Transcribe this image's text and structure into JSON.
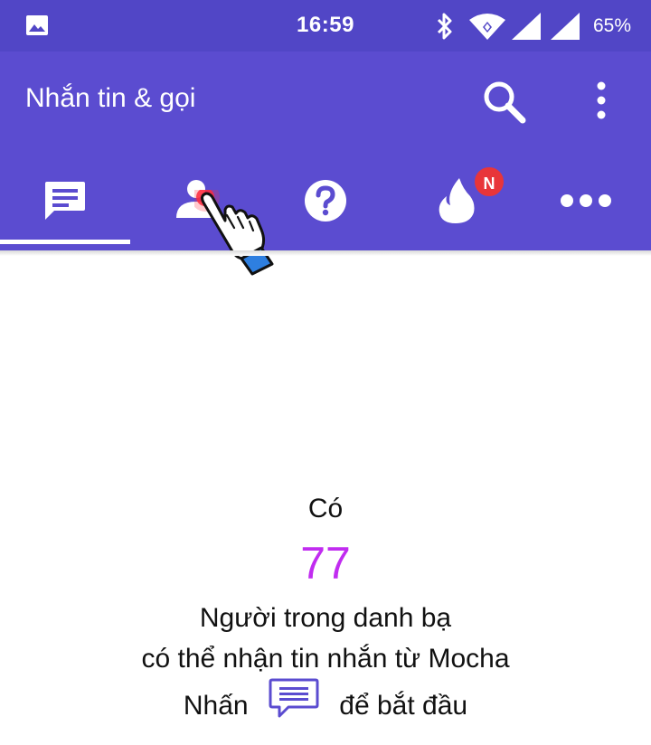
{
  "status_bar": {
    "time": "16:59",
    "battery": "65%",
    "icons": [
      "gallery-icon",
      "bluetooth-icon",
      "wifi-icon",
      "signal-icon",
      "signal-icon"
    ]
  },
  "app_bar": {
    "title": "Nhắn tin & gọi",
    "actions": [
      "search-icon",
      "more-vert-icon"
    ]
  },
  "tabs": [
    {
      "icon": "chat-icon",
      "selected": true
    },
    {
      "icon": "contacts-icon",
      "selected": false
    },
    {
      "icon": "help-icon",
      "selected": false
    },
    {
      "icon": "flame-icon",
      "selected": false,
      "badge": "N"
    },
    {
      "icon": "more-horiz-icon",
      "selected": false
    }
  ],
  "empty_state": {
    "prefix": "Có",
    "count": "77",
    "line1": "Người trong danh bạ",
    "line2": "có thể nhận tin nhắn từ Mocha",
    "line3_before": "Nhấn",
    "line3_icon": "chat-icon",
    "line3_after": "để bắt đầu"
  },
  "colors": {
    "status_bar": "#5146c6",
    "app_bar": "#5b4cd0",
    "count": "#c12cf0",
    "badge": "#e8353a",
    "inline_icon": "#5b4cd0"
  }
}
